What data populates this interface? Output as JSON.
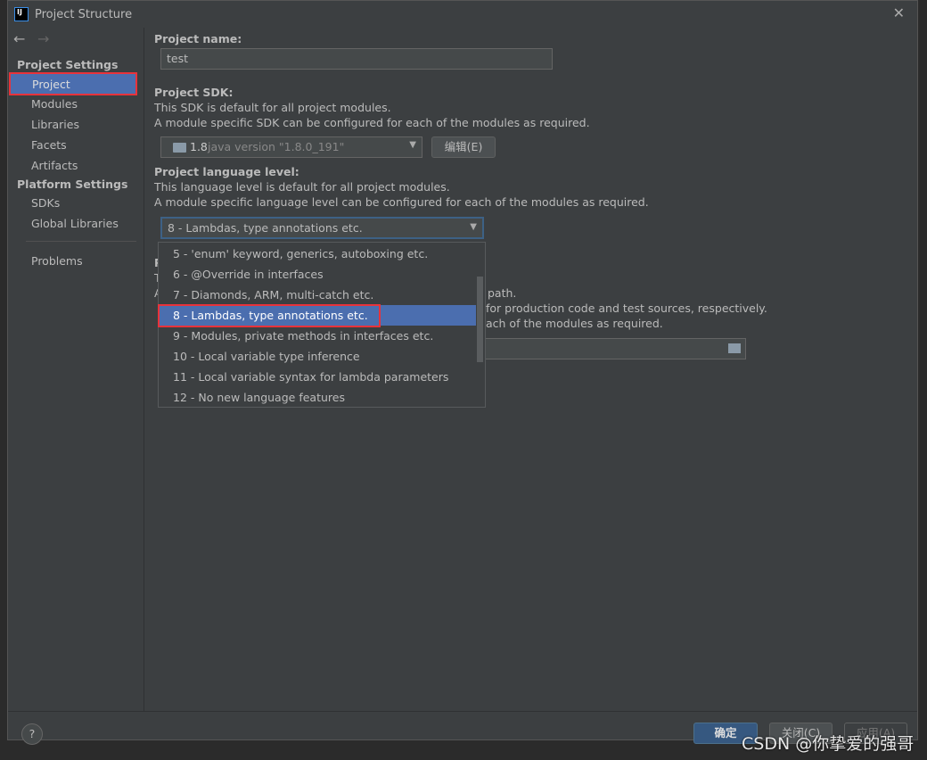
{
  "window": {
    "title": "Project Structure",
    "app_icon": "intellij-icon"
  },
  "sidebar": {
    "sections": [
      {
        "label": "Project Settings",
        "items": [
          "Project",
          "Modules",
          "Libraries",
          "Facets",
          "Artifacts"
        ]
      },
      {
        "label": "Platform Settings",
        "items": [
          "SDKs",
          "Global Libraries"
        ]
      }
    ],
    "problems": "Problems",
    "selected": "Project"
  },
  "main": {
    "project_name": {
      "label": "Project name:",
      "value": "test"
    },
    "sdk": {
      "label": "Project SDK:",
      "desc1": "This SDK is default for all project modules.",
      "desc2": "A module specific SDK can be configured for each of the modules as required.",
      "version": "1.8",
      "detail": "java version \"1.8.0_191\"",
      "edit_button": "编辑(E)"
    },
    "language": {
      "label": "Project language level:",
      "desc1": "This language level is default for all project modules.",
      "desc2": "A module specific language level can be configured for each of the modules as required.",
      "selected": "8 - Lambdas, type annotations etc.",
      "options": [
        "5 - 'enum' keyword, generics, autoboxing etc.",
        "6 - @Override in interfaces",
        "7 - Diamonds, ARM, multi-catch etc.",
        "8 - Lambdas, type annotations etc.",
        "9 - Modules, private methods in interfaces etc.",
        "10 - Local variable type inference",
        "11 - Local variable syntax for lambda parameters",
        "12 - No new language features"
      ]
    },
    "compiler": {
      "label_frag": "P",
      "line1_frag": "T",
      "line2_frag": "A",
      "line2_end": "path.",
      "line3_end": "for production code and test sources, respectively.",
      "line4_end": "ach of the modules as required."
    }
  },
  "footer": {
    "ok": "确定",
    "close": "关闭(C)",
    "apply": "应用(A)",
    "help": "?"
  },
  "watermark": "CSDN @你挚爱的强哥",
  "colors": {
    "selection": "#4b6eaf",
    "highlight_box": "#e8333b",
    "primary_button": "#365880"
  }
}
